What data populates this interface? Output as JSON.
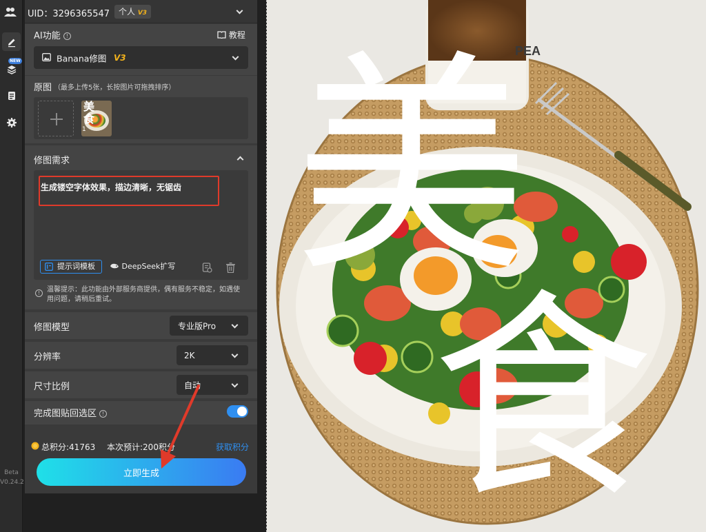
{
  "header": {
    "uid_label": "UID：3296365547",
    "account_badge": "个人",
    "account_level": "V3"
  },
  "rail": {
    "new_badge": "NEW",
    "beta_label": "Beta",
    "version": "V0.24.2"
  },
  "ai_function": {
    "label": "AI功能",
    "tutorial_label": "教程",
    "selected_tool": "Banana修图",
    "selected_tool_version": "V3"
  },
  "original": {
    "label": "原图",
    "hint": "（最多上传5张，长按图片可拖拽排序）",
    "thumbnails": [
      {
        "index": "1",
        "text": "美食"
      }
    ]
  },
  "request": {
    "label": "修图需求",
    "prompt_text": "生成镂空字体效果，描边清晰，无锯齿",
    "template_button": "提示词模板",
    "deepseek_button": "DeepSeek扩写"
  },
  "notice": {
    "text": "温馨提示：此功能由外部服务商提供，偶有服务不稳定，如遇使用问题，请稍后重试。"
  },
  "model": {
    "label": "修图模型",
    "value": "专业版Pro"
  },
  "resolution": {
    "label": "分辨率",
    "value": "2K"
  },
  "ratio": {
    "label": "尺寸比例",
    "value": "自动"
  },
  "paste_back": {
    "label": "完成图贴回选区",
    "enabled": true
  },
  "points": {
    "total_label": "总积分:41763",
    "estimate_label": "本次预计:200积分",
    "get_points_link": "获取积分"
  },
  "generate_button": "立即生成",
  "canvas": {
    "overlay_text": "美食",
    "cup_text": "PEA"
  },
  "colors": {
    "accent_blue": "#2f8ff0",
    "button_gradient_start": "#1fe0e8",
    "button_gradient_end": "#3a7bf2",
    "highlight_red": "#e03a2a",
    "toggle_on": "#2f8ff0",
    "gold": "#f2b21c"
  }
}
